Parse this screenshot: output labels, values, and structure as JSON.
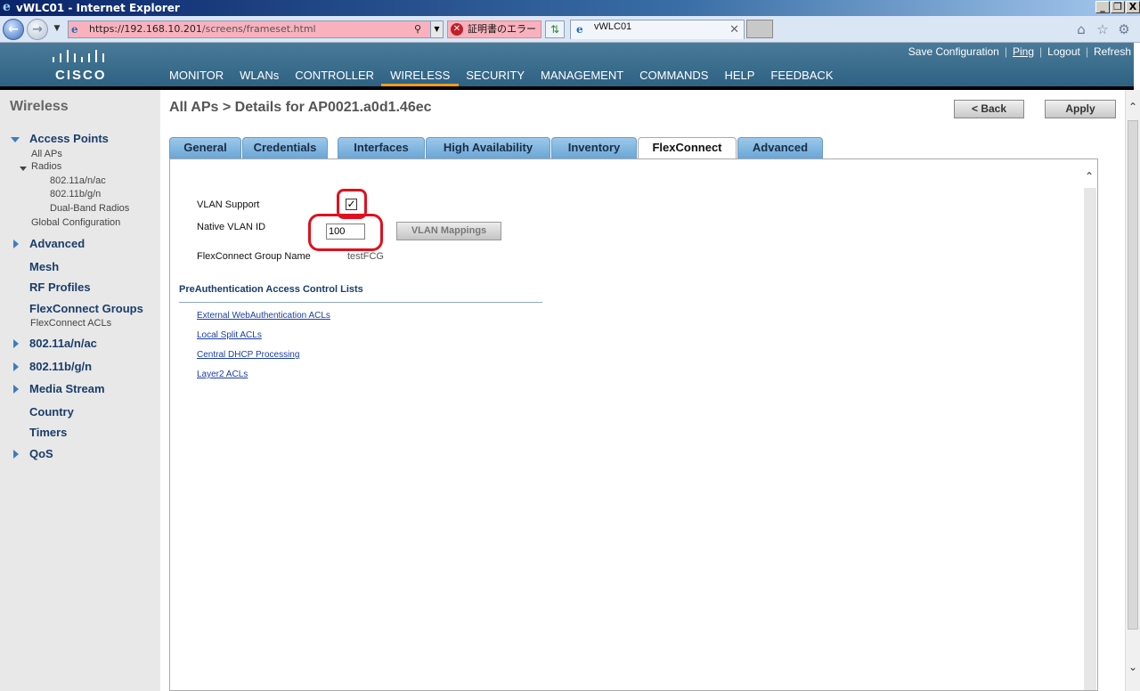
{
  "window": {
    "title": "vWLC01 - Internet Explorer",
    "controls": [
      "_",
      "❐",
      "X"
    ]
  },
  "browser": {
    "url_host": "https://192.168.10.201",
    "url_path": "/screens/frameset.html",
    "cert_error": "証明書のエラー",
    "tab_title": "vWLC01",
    "icons": [
      "back-icon",
      "forward-icon",
      "home-icon",
      "favorites-icon",
      "tools-icon"
    ]
  },
  "header": {
    "logo_text": "CISCO",
    "top_links": [
      "Save Configuration",
      "Ping",
      "Logout",
      "Refresh"
    ],
    "nav": [
      "MONITOR",
      "WLANs",
      "CONTROLLER",
      "WIRELESS",
      "SECURITY",
      "MANAGEMENT",
      "COMMANDS",
      "HELP",
      "FEEDBACK"
    ],
    "active_nav": "WIRELESS",
    "accent_color": "#f29c1f"
  },
  "sidebar": {
    "title": "Wireless",
    "access_points": "Access Points",
    "all_aps": "All APs",
    "radios": "Radios",
    "radio_items": [
      "802.11a/n/ac",
      "802.11b/g/n",
      "Dual-Band Radios"
    ],
    "global_config": "Global Configuration",
    "advanced": "Advanced",
    "mesh": "Mesh",
    "rf_profiles": "RF Profiles",
    "flexconnect_groups": "FlexConnect Groups",
    "flexconnect_acls": "FlexConnect ACLs",
    "dot11a": "802.11a/n/ac",
    "dot11b": "802.11b/g/n",
    "media_stream": "Media Stream",
    "country": "Country",
    "timers": "Timers",
    "qos": "QoS"
  },
  "main": {
    "title": "All APs > Details for AP0021.a0d1.46ec",
    "back_label": "< Back",
    "apply_label": "Apply",
    "tabs": [
      "General",
      "Credentials",
      "Interfaces",
      "High Availability",
      "Inventory",
      "FlexConnect",
      "Advanced"
    ],
    "active_tab": "FlexConnect",
    "vlan_support_label": "VLAN Support",
    "vlan_support_checked": true,
    "native_vlan_label": "Native VLAN ID",
    "native_vlan_value": "100",
    "vlan_mappings_label": "VLAN Mappings",
    "group_name_label": "FlexConnect Group Name",
    "group_name_value": "testFCG",
    "preauth_title": "PreAuthentication Access Control Lists",
    "acl_links": [
      "External WebAuthentication ACLs",
      "Local Split ACLs",
      "Central DHCP Processing",
      "Layer2 ACLs"
    ],
    "callout_color": "#e0101e"
  }
}
